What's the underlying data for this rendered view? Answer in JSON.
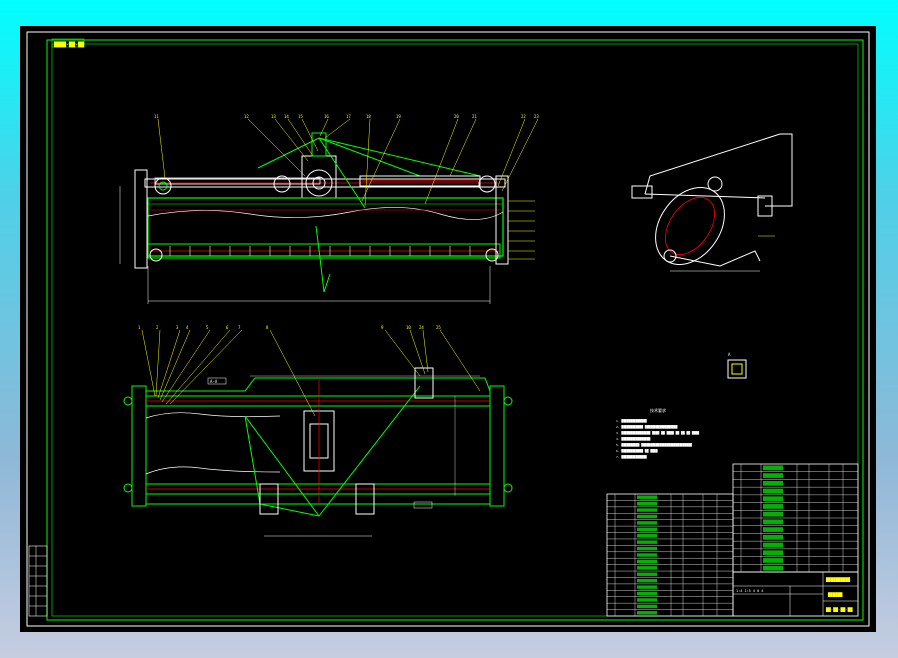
{
  "drawing": {
    "top_left_tag": "████-██-██",
    "title_block": {
      "name_line1": "██████████",
      "name_line2": "██████",
      "drawing_no": "██-██-██-██",
      "scale_row": "1:4  1:5 4 0 4"
    },
    "section_label": "A-A",
    "detail_label": "A",
    "notes_heading": "技术要求",
    "notes": [
      "1. ██████████████",
      "2. ████████████  ██████████████████",
      "3. ████████████████  ████  ██  ████  ██  ██  ██  ████",
      "4. ████████████████",
      "5. ██████████  ████████████████████████████",
      "6. ████████████  ██  ████",
      "7. ██████████████"
    ],
    "parts_table_rows": 19,
    "parts_table_right_rows": 14
  },
  "colors": {
    "frame": "#ffffff",
    "border": "#00ff00",
    "part": "#ffff00",
    "line": "#00ff00",
    "accent": "#ff0000",
    "dim": "#ffffff"
  }
}
